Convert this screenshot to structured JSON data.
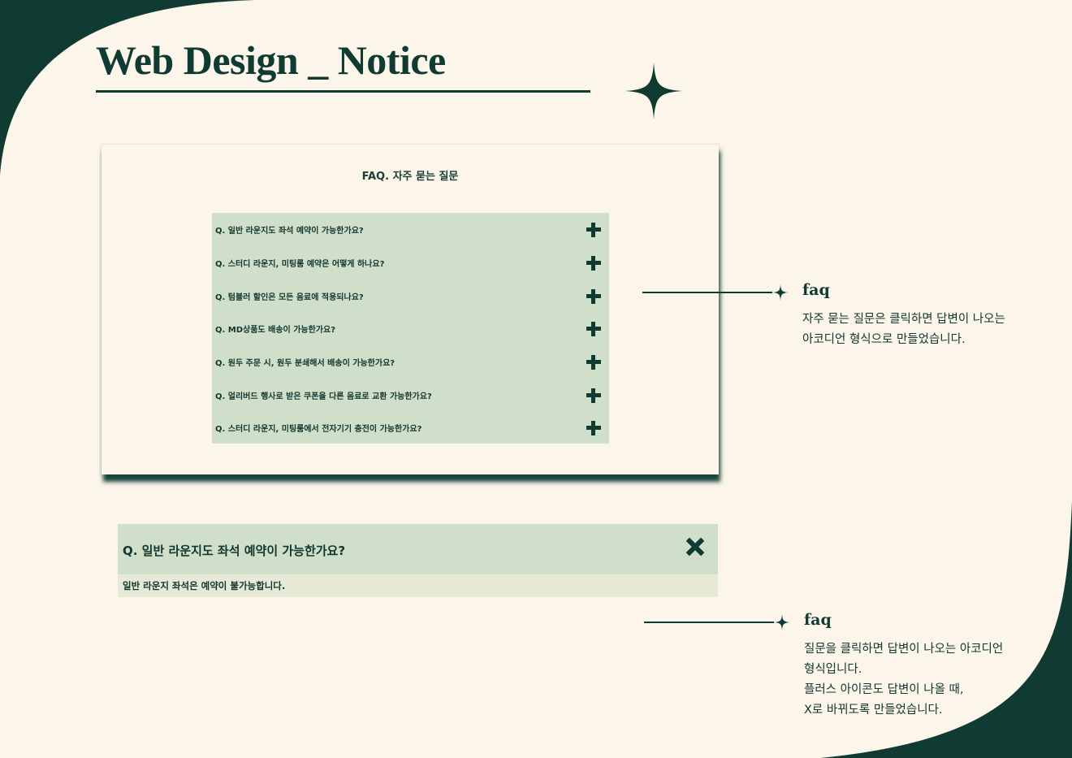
{
  "header": {
    "title": "Web Design _ Notice"
  },
  "faq_card": {
    "title": "FAQ. 자주 묻는 질문",
    "items": [
      "Q. 일반 라운지도 좌석 예약이 가능한가요?",
      "Q. 스터디 라운지, 미팅룸 예약은 어떻게 하나요?",
      "Q. 텀블러 할인은 모든 음료에 적용되나요?",
      "Q. MD상품도 배송이 가능한가요?",
      "Q. 원두 주문 시, 원두 분쇄해서 배송이 가능한가요?",
      "Q. 얼리버드 행사로 받은 쿠폰을 다른 음료로 교환 가능한가요?",
      "Q. 스터디 라운지, 미팅룸에서 전자기기 충전이 가능한가요?"
    ]
  },
  "expanded_faq": {
    "question": "Q. 일반 라운지도 좌석 예약이 가능한가요?",
    "answer": "일반 라운지 좌석은 예약이 불가능합니다."
  },
  "notes": [
    {
      "heading": "faq",
      "lines": [
        "자주 묻는 질문은 클릭하면 답변이 나오는",
        "아코디언 형식으로 만들었습니다."
      ]
    },
    {
      "heading": "faq",
      "lines": [
        "질문을 클릭하면 답변이 나오는 아코디언",
        "형식입니다.",
        "플러스 아이콘도 답변이 나올 때,",
        "X로 바뀌도록 만들었습니다."
      ]
    }
  ],
  "colors": {
    "dark_green": "#0f3b33",
    "cream": "#fbf5ea",
    "sage": "#d0dfc9",
    "pale_sage": "#e5e9d6"
  },
  "icons": {
    "sparkle": "sparkle-icon",
    "expand": "plus-icon",
    "collapse": "close-icon"
  }
}
